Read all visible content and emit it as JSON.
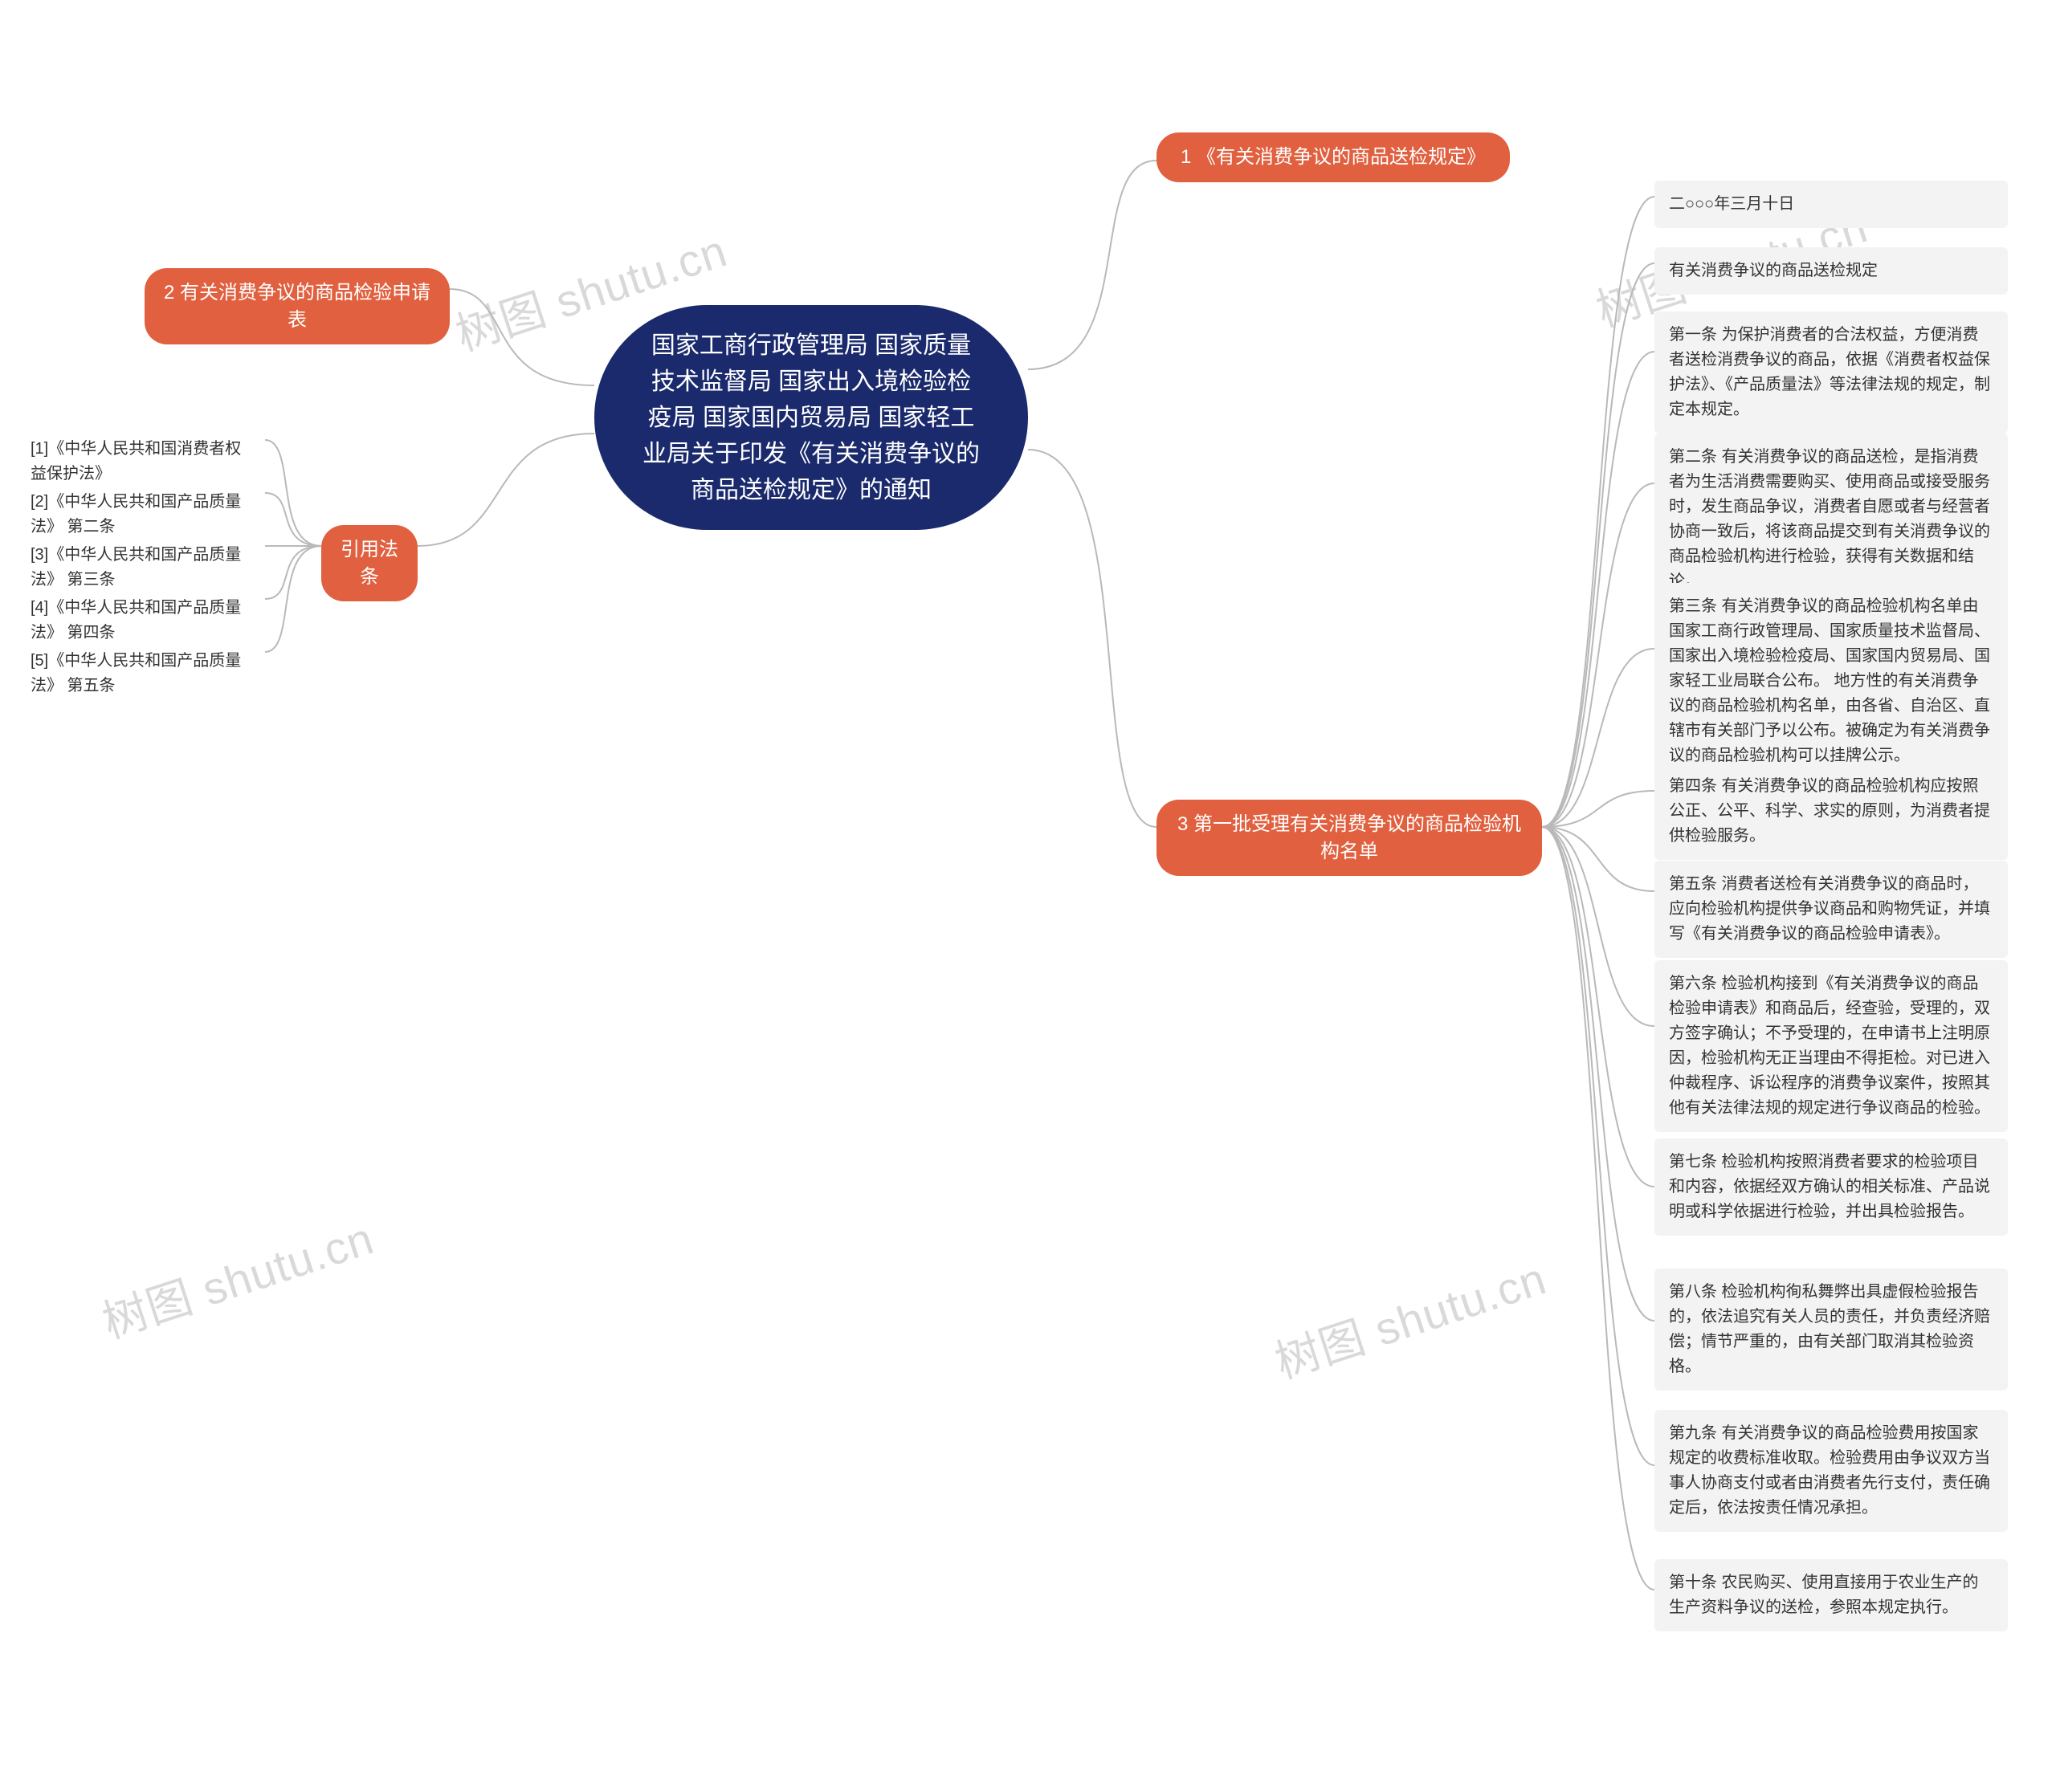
{
  "root": {
    "title": "国家工商行政管理局 国家质量技术监督局 国家出入境检验检疫局 国家国内贸易局 国家轻工业局关于印发《有关消费争议的商品送检规定》的通知"
  },
  "branches": {
    "b1": {
      "label": "1 《有关消费争议的商品送检规定》"
    },
    "b2": {
      "label": "2 有关消费争议的商品检验申请表"
    },
    "b3": {
      "label": "3 第一批受理有关消费争议的商品检验机构名单"
    },
    "b4": {
      "label": "引用法条"
    }
  },
  "laws": [
    "[1]《中华人民共和国消费者权益保护法》",
    "[2]《中华人民共和国产品质量法》 第二条",
    "[3]《中华人民共和国产品质量法》 第三条",
    "[4]《中华人民共和国产品质量法》 第四条",
    "[5]《中华人民共和国产品质量法》 第五条"
  ],
  "articles": [
    "二○○○年三月十日",
    "有关消费争议的商品送检规定",
    "第一条 为保护消费者的合法权益，方便消费者送检消费争议的商品，依据《消费者权益保护法》、《产品质量法》等法律法规的规定，制定本规定。",
    "第二条 有关消费争议的商品送检，是指消费者为生活消费需要购买、使用商品或接受服务时，发生商品争议，消费者自愿或者与经营者协商一致后，将该商品提交到有关消费争议的商品检验机构进行检验，获得有关数据和结论。",
    "第三条 有关消费争议的商品检验机构名单由国家工商行政管理局、国家质量技术监督局、国家出入境检验检疫局、国家国内贸易局、国家轻工业局联合公布。 地方性的有关消费争议的商品检验机构名单，由各省、自治区、直辖市有关部门予以公布。被确定为有关消费争议的商品检验机构可以挂牌公示。",
    "第四条 有关消费争议的商品检验机构应按照公正、公平、科学、求实的原则，为消费者提供检验服务。",
    "第五条 消费者送检有关消费争议的商品时，应向检验机构提供争议商品和购物凭证，并填写《有关消费争议的商品检验申请表》。",
    "第六条 检验机构接到《有关消费争议的商品检验申请表》和商品后，经查验，受理的，双方签字确认；不予受理的，在申请书上注明原因，检验机构无正当理由不得拒检。对已进入仲裁程序、诉讼程序的消费争议案件，按照其他有关法律法规的规定进行争议商品的检验。",
    "第七条 检验机构按照消费者要求的检验项目和内容，依据经双方确认的相关标准、产品说明或科学依据进行检验，并出具检验报告。",
    "第八条 检验机构徇私舞弊出具虚假检验报告的，依法追究有关人员的责任，并负责经济赔偿；情节严重的，由有关部门取消其检验资格。",
    "第九条 有关消费争议的商品检验费用按国家规定的收费标准收取。检验费用由争议双方当事人协商支付或者由消费者先行支付，责任确定后，依法按责任情况承担。",
    "第十条 农民购买、使用直接用于农业生产的生产资料争议的送检，参照本规定执行。"
  ],
  "watermark": "树图 shutu.cn",
  "colors": {
    "root_bg": "#1a2a6c",
    "branch_bg": "#e0603f",
    "leaf_bg": "#f3f3f3",
    "connector": "#b9b9b9"
  }
}
